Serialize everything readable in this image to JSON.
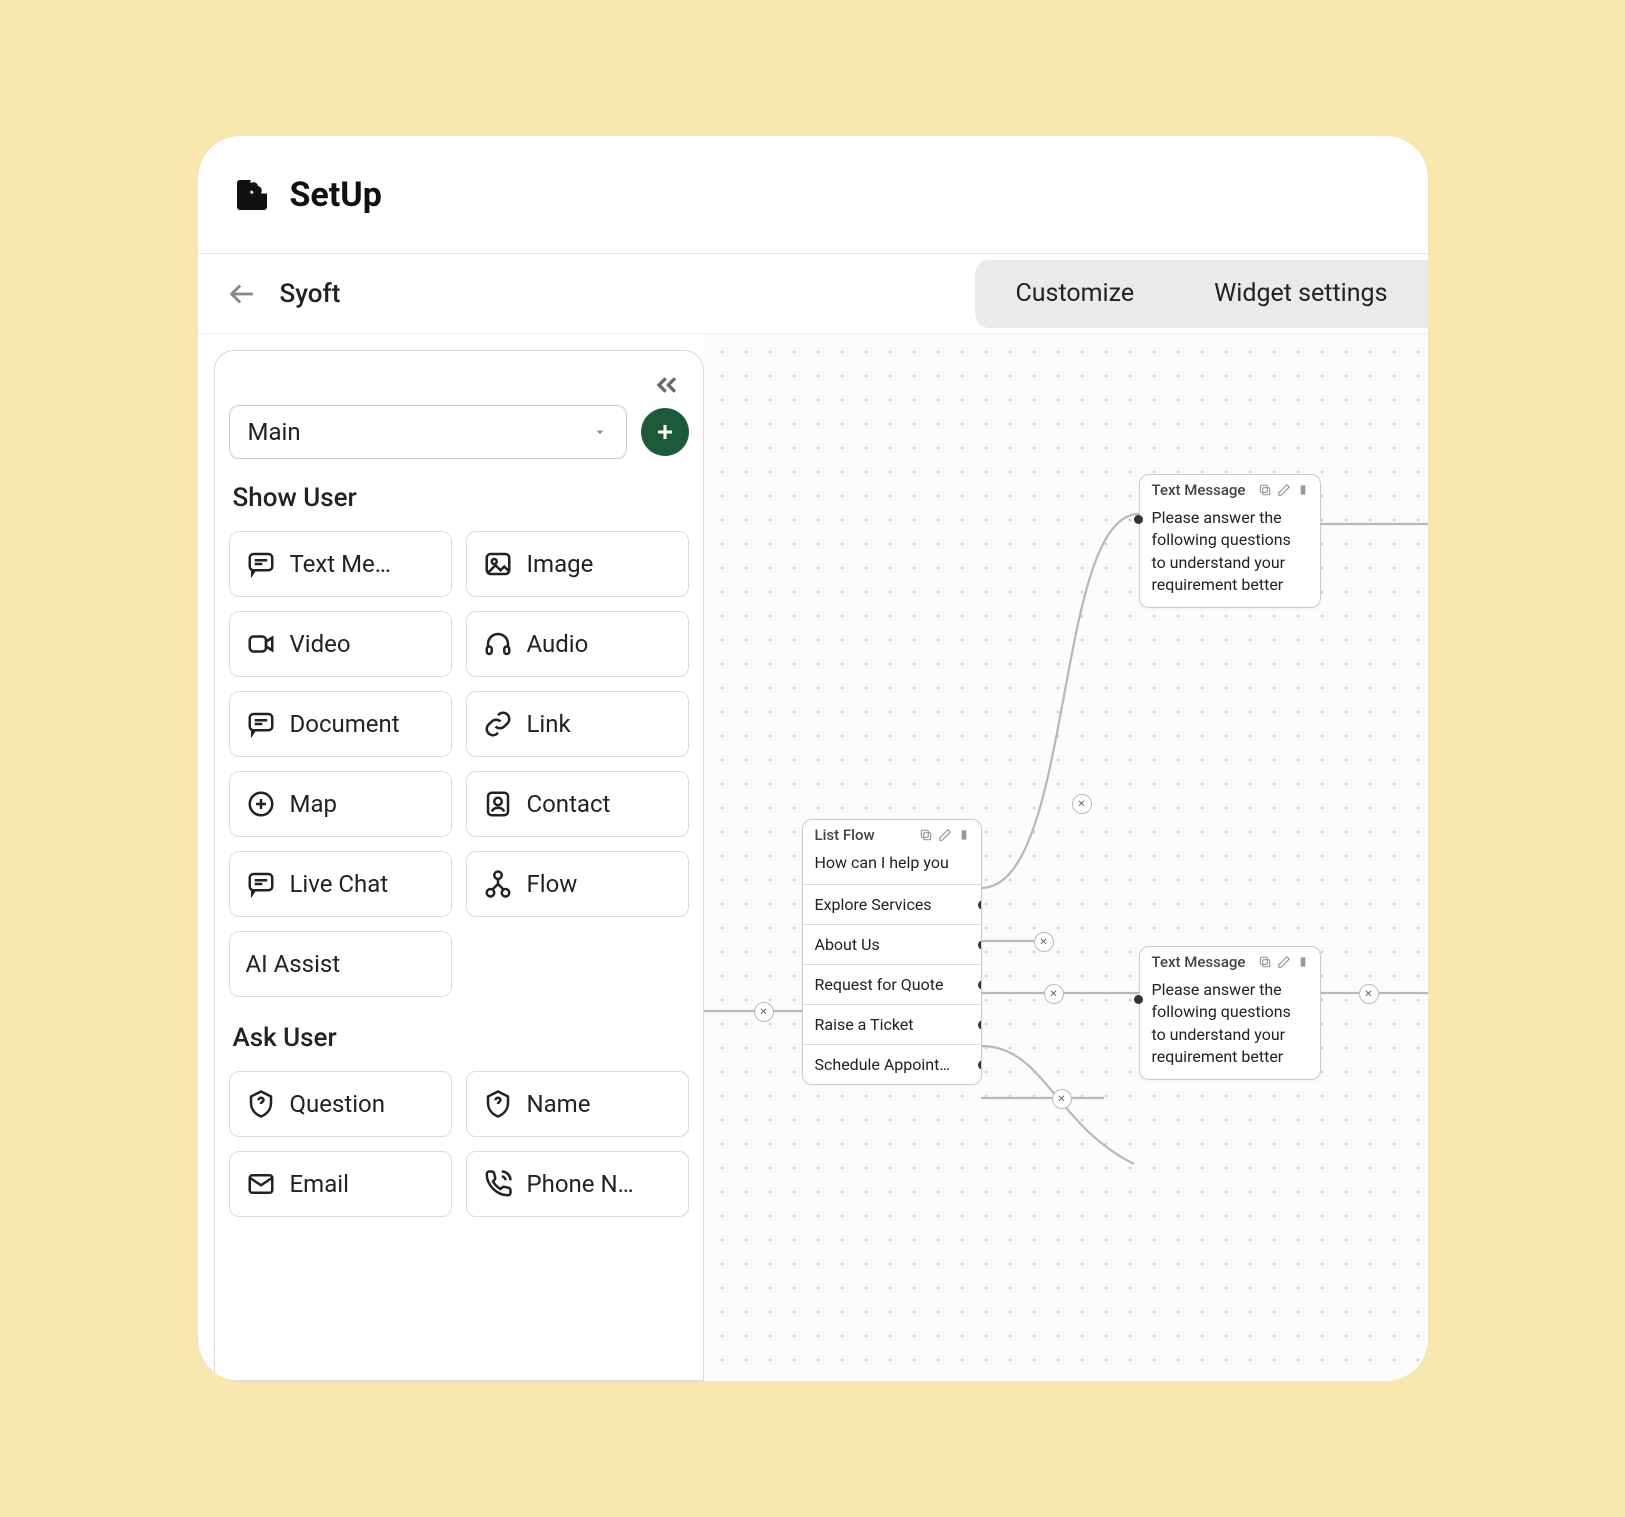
{
  "header": {
    "title": "SetUp"
  },
  "breadcrumb": "Syoft",
  "tabs": {
    "customize": "Customize",
    "widget": "Widget settings"
  },
  "sidebar": {
    "selector_value": "Main",
    "section_show": "Show User",
    "section_ask": "Ask User",
    "show_blocks": {
      "text": "Text Me…",
      "image": "Image",
      "video": "Video",
      "audio": "Audio",
      "document": "Document",
      "link": "Link",
      "map": "Map",
      "contact": "Contact",
      "livechat": "Live Chat",
      "flow": "Flow",
      "ai": "AI Assist"
    },
    "ask_blocks": {
      "question": "Question",
      "name": "Name",
      "email": "Email",
      "phone": "Phone N…"
    }
  },
  "nodes": {
    "textmsg1": {
      "title": "Text Message",
      "body": "Please answer the following questions to understand your requirement better"
    },
    "textmsg2": {
      "title": "Text Message",
      "body": "Please answer the following questions to understand your requirement better"
    },
    "listflow": {
      "title": "List Flow",
      "prompt": "How can I help you",
      "options": [
        "Explore Services",
        "About Us",
        "Request for Quote",
        "Raise a Ticket",
        "Schedule Appoint…"
      ]
    }
  }
}
